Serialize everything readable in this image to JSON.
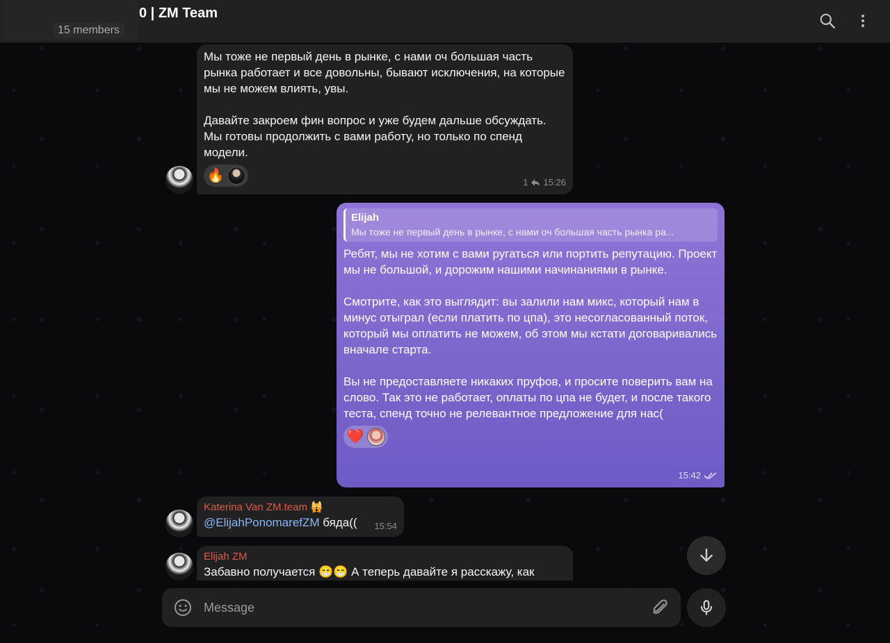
{
  "header": {
    "title": "0 | ZM Team",
    "members": "15 members"
  },
  "messages": [
    {
      "text": "Мы тоже не первый день в рынке, с нами оч большая часть рынка работает и все довольны, бывают исключения, на которые мы не можем влиять, увы.\n\nДавайте закроем фин вопрос и уже будем дальше обсуждать. Мы готовы продолжить с вами работу, но только по спенд модели.",
      "reactions": [
        "🔥"
      ],
      "replies": "1",
      "time": "15:26"
    },
    {
      "reply_name": "Elijah",
      "reply_text": "Мы тоже не первый день в рынке, с нами оч большая часть рынка ра...",
      "text": "Ребят, мы не хотим с вами ругаться или портить репутацию. Проект мы не большой, и дорожим нашими начинаниями в рынке.\n\nСмотрите, как это выглядит: вы залили нам микс, который нам в минус отыграл (если платить по цпа), это несогласованный поток, который мы оплатить не можем, об этом мы кстати договаривались вначале старта.\n\nВы не предоставляете никаких пруфов, и просите поверить вам на слово. Так это не работает, оплаты по цпа не будет, и после такого теста, спенд точно не релевантное предложение для нас(",
      "reactions": [
        "❤️"
      ],
      "time": "15:42"
    },
    {
      "sender": "Katerina Van ZM.team 🙀",
      "sender_color": "#e0584c",
      "mention": "@ElijahPonomarefZM",
      "text": " бяда((",
      "time": "15:54"
    },
    {
      "sender": "Elijah ZM",
      "sender_color": "#e0584c",
      "text": "Забавно получается 😁😁 А теперь давайте я расскажу, как"
    }
  ],
  "composer": {
    "placeholder": "Message"
  },
  "colors": {
    "outgoing": "#7b66cc",
    "incoming": "#212121",
    "header": "#212121"
  }
}
